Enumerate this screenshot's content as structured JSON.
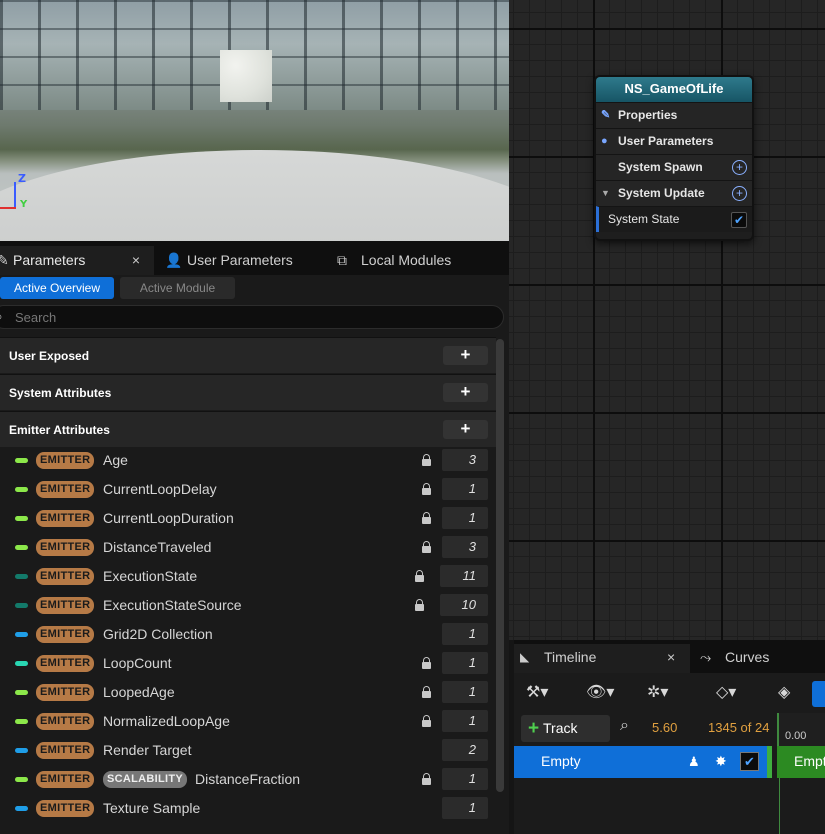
{
  "viewport": {
    "axis_z": "Z",
    "axis_y": "Y"
  },
  "node": {
    "title": "NS_GameOfLife",
    "rows": [
      {
        "label": "Properties",
        "icon": "pencil-icon"
      },
      {
        "label": "User Parameters",
        "icon": "user-icon"
      },
      {
        "label": "System Spawn"
      },
      {
        "label": "System Update",
        "icon": "triangle-down-icon"
      },
      {
        "label": "System State",
        "checked": true
      }
    ]
  },
  "params": {
    "tabs": [
      {
        "label": "Parameters",
        "close": "×"
      },
      {
        "label": "User Parameters"
      },
      {
        "label": "Local Modules"
      }
    ],
    "modes": {
      "active": "Active Overview",
      "inactive": "Active Module"
    },
    "search_placeholder": "Search",
    "sections": [
      {
        "label": "User Exposed",
        "add": "+"
      },
      {
        "label": "System Attributes",
        "add": "+"
      },
      {
        "label": "Emitter Attributes",
        "add": "+"
      }
    ],
    "rows": [
      {
        "badge": "EMITTER",
        "name": "Age",
        "count": "3",
        "locked": true,
        "color": "#8ce84a"
      },
      {
        "badge": "EMITTER",
        "name": "CurrentLoopDelay",
        "count": "1",
        "locked": true,
        "color": "#8ce84a"
      },
      {
        "badge": "EMITTER",
        "name": "CurrentLoopDuration",
        "count": "1",
        "locked": true,
        "color": "#8ce84a"
      },
      {
        "badge": "EMITTER",
        "name": "DistanceTraveled",
        "count": "3",
        "locked": true,
        "color": "#8ce84a"
      },
      {
        "badge": "EMITTER",
        "name": "ExecutionState",
        "count": "11",
        "locked": true,
        "color": "#137a6a"
      },
      {
        "badge": "EMITTER",
        "name": "ExecutionStateSource",
        "count": "10",
        "locked": true,
        "color": "#137a6a"
      },
      {
        "badge": "EMITTER",
        "name": "Grid2D Collection",
        "count": "1",
        "locked": false,
        "color": "#1f9ee8"
      },
      {
        "badge": "EMITTER",
        "name": "LoopCount",
        "count": "1",
        "locked": true,
        "color": "#29d6b2"
      },
      {
        "badge": "EMITTER",
        "name": "LoopedAge",
        "count": "1",
        "locked": true,
        "color": "#8ce84a"
      },
      {
        "badge": "EMITTER",
        "name": "NormalizedLoopAge",
        "count": "1",
        "locked": true,
        "color": "#8ce84a"
      },
      {
        "badge": "EMITTER",
        "name": "Render Target",
        "count": "2",
        "locked": false,
        "color": "#1f9ee8"
      },
      {
        "badge": "EMITTER",
        "badge2": "SCALABILITY",
        "name": "DistanceFraction",
        "count": "1",
        "locked": true,
        "color": "#8ce84a"
      },
      {
        "badge": "EMITTER",
        "name": "Texture Sample",
        "count": "1",
        "locked": false,
        "color": "#1f9ee8"
      }
    ]
  },
  "timeline": {
    "tabs": [
      {
        "label": "Timeline",
        "close": "×"
      },
      {
        "label": "Curves"
      }
    ],
    "track_button": "Track",
    "time": "5.60",
    "frame": "1345 of 24",
    "scrub_time": "0.00",
    "row_label": "Empty",
    "track_label": "Empty",
    "track_checked": true
  },
  "colors": {
    "accent": "#0f6fd8",
    "node_header": "#2e7a8c",
    "emitter_badge": "#b67a46",
    "track_green": "#2c8a22",
    "frame_orange": "#e0a040"
  }
}
